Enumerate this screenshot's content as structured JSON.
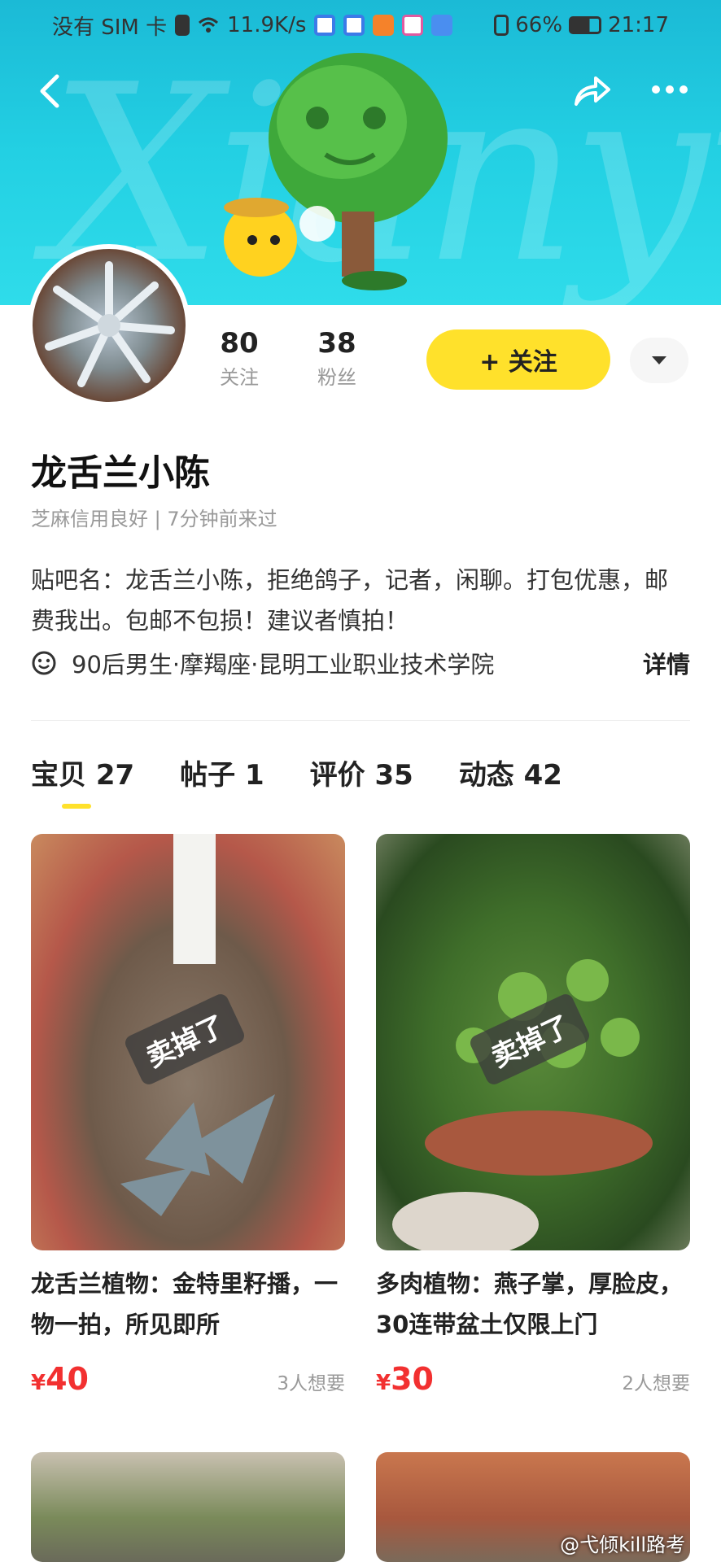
{
  "status_bar": {
    "carrier": "没有 SIM 卡",
    "speed": "11.9K/s",
    "battery": "66%",
    "time": "21:17"
  },
  "profile": {
    "name": "龙舌兰小陈",
    "credit": "芝麻信用良好 | 7分钟前来过",
    "bio": "贴吧名：龙舌兰小陈，拒绝鸽子，记者，闲聊。打包优惠，邮费我出。包邮不包损！建议者慎拍！",
    "info": "90后男生·摩羯座·昆明工业职业技术学院",
    "detail_label": "详情",
    "following_count": "80",
    "following_label": "关注",
    "followers_count": "38",
    "followers_label": "粉丝",
    "follow_button": "+ 关注"
  },
  "tabs": [
    {
      "label": "宝贝 27"
    },
    {
      "label": "帖子 1"
    },
    {
      "label": "评价 35"
    },
    {
      "label": "动态 42"
    }
  ],
  "items": [
    {
      "title": "龙舌兰植物：金特里籽播，一物一拍，所见即所",
      "price_symbol": "¥",
      "price": "40",
      "wants": "3人想要",
      "tag": "卖掉了"
    },
    {
      "title": "多肉植物：燕子掌，厚脸皮，30连带盆土仅限上门",
      "price_symbol": "¥",
      "price": "30",
      "wants": "2人想要",
      "tag": "卖掉了"
    }
  ],
  "watermark": "@弋倾kill路考",
  "colors": {
    "accent": "#ffe12b",
    "price": "#f23030",
    "banner": "#23d0e3"
  }
}
